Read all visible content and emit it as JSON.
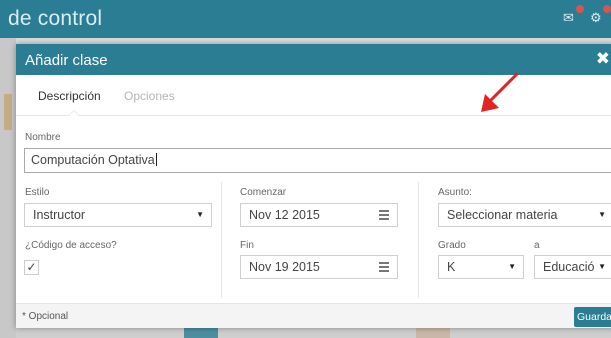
{
  "topbar": {
    "title": "de control"
  },
  "modal": {
    "title": "Añadir clase",
    "close_icon": "✖",
    "tabs": [
      {
        "label": "Descripción",
        "active": true
      },
      {
        "label": "Opciones",
        "active": false
      }
    ],
    "nombre": {
      "label": "Nombre",
      "value": "Computación Optativa"
    },
    "estilo": {
      "label": "Estilo",
      "value": "Instructor"
    },
    "codigo": {
      "label": "¿Código de acceso?",
      "checked": true,
      "check_mark": "✓"
    },
    "comenzar": {
      "label": "Comenzar",
      "value": "Nov 12 2015"
    },
    "fin": {
      "label": "Fin",
      "value": "Nov 19 2015"
    },
    "asunto": {
      "label": "Asunto:",
      "value": "Seleccionar materia"
    },
    "grado": {
      "label": "Grado",
      "value": "K"
    },
    "a": {
      "label": "a",
      "value": "Educació"
    },
    "footer": {
      "optional_note": "* Opcional",
      "save_label": "Guardar"
    }
  },
  "icons": {
    "select_arrow": "▼",
    "calendar": "calendar-icon",
    "arrow_color": "#e02424"
  },
  "colors": {
    "header": "#2a7d93",
    "accent_red": "#e02424"
  }
}
